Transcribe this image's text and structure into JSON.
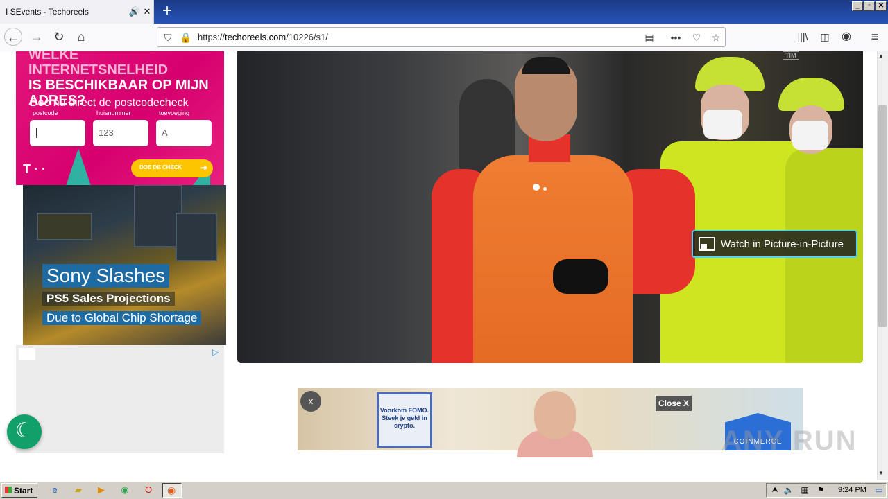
{
  "browser": {
    "tab_title": "I SEvents - Techoreels",
    "url": "https://techoreels.com/10226/s1/",
    "url_prefix": "https://",
    "url_domain": "techoreels.com",
    "url_path": "/10226/s1/"
  },
  "ad_telekom": {
    "headline": "IS BESCHIKBAAR OP MIJN ADRES?",
    "sub": "Doe nu direct de postcodecheck",
    "labels": {
      "postcode": "postcode",
      "huisnummer": "huisnummer",
      "toevoeging": "toevoeging"
    },
    "values": {
      "postcode": "",
      "huisnummer": "123",
      "toevoeging": "A"
    },
    "button": "DOE DE CHECK",
    "logo": "T · ·"
  },
  "ad_sony": {
    "title": "Sony Slashes",
    "line2": "PS5 Sales Projections",
    "line3": "Due to Global Chip Shortage"
  },
  "video": {
    "pip_label": "Watch in Picture-in-Picture",
    "tim_logo": "TIM"
  },
  "banner": {
    "close_x": "x",
    "tile_text": "Voorkom FOMO. Steek je geld in crypto.",
    "close_label": "Close X",
    "brand": "COINMERCE"
  },
  "watermark": "ANY RUN",
  "taskbar": {
    "start": "Start",
    "clock": "9:24 PM"
  }
}
